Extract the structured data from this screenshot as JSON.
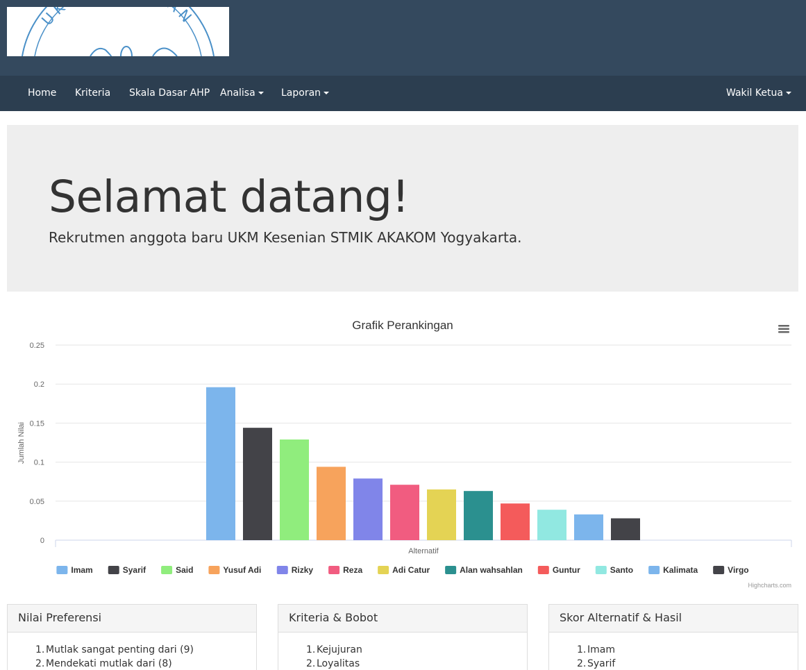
{
  "logo": {
    "text": "UKM KESENIAN"
  },
  "nav": {
    "items": [
      {
        "label": "Home",
        "dropdown": false
      },
      {
        "label": "Kriteria",
        "dropdown": false
      },
      {
        "label": "Skala Dasar AHP",
        "dropdown": false
      },
      {
        "label": "Analisa",
        "dropdown": true
      },
      {
        "label": "Laporan",
        "dropdown": true
      }
    ],
    "user": {
      "label": "Wakil Ketua",
      "dropdown": true
    }
  },
  "jumbotron": {
    "title": "Selamat datang!",
    "subtitle": "Rekrutmen anggota baru UKM Kesenian STMIK AKAKOM Yogyakarta."
  },
  "chart_data": {
    "type": "bar",
    "title": "Grafik Perankingan",
    "xlabel": "Alternatif",
    "ylabel": "Jumlah Nilai",
    "ylim": [
      0,
      0.25
    ],
    "yticks": [
      "0",
      "0.05",
      "0.1",
      "0.15",
      "0.2",
      "0.25"
    ],
    "grid": true,
    "legend_position": "bottom",
    "credits": "Highcharts.com",
    "series": [
      {
        "name": "Imam",
        "value": 0.196,
        "color": "#7cb5ec"
      },
      {
        "name": "Syarif",
        "value": 0.144,
        "color": "#434348"
      },
      {
        "name": "Said",
        "value": 0.129,
        "color": "#90ed7d"
      },
      {
        "name": "Yusuf Adi",
        "value": 0.094,
        "color": "#f7a35c"
      },
      {
        "name": "Rizky",
        "value": 0.079,
        "color": "#8085e9"
      },
      {
        "name": "Reza",
        "value": 0.071,
        "color": "#f15c80"
      },
      {
        "name": "Adi Catur",
        "value": 0.065,
        "color": "#e4d354"
      },
      {
        "name": "Alan wahsahlan",
        "value": 0.063,
        "color": "#2b908f"
      },
      {
        "name": "Guntur",
        "value": 0.047,
        "color": "#f45b5b"
      },
      {
        "name": "Santo",
        "value": 0.039,
        "color": "#91e8e1"
      },
      {
        "name": "Kalimata",
        "value": 0.033,
        "color": "#7cb5ec"
      },
      {
        "name": "Virgo",
        "value": 0.028,
        "color": "#434348"
      }
    ]
  },
  "panels": [
    {
      "title": "Nilai Preferensi",
      "items": [
        "Mutlak sangat penting dari (9)",
        "Mendekati mutlak dari (8)"
      ]
    },
    {
      "title": "Kriteria & Bobot",
      "items": [
        "Kejujuran",
        "Loyalitas"
      ]
    },
    {
      "title": "Skor Alternatif & Hasil",
      "items": [
        "Imam",
        "Syarif"
      ]
    }
  ]
}
